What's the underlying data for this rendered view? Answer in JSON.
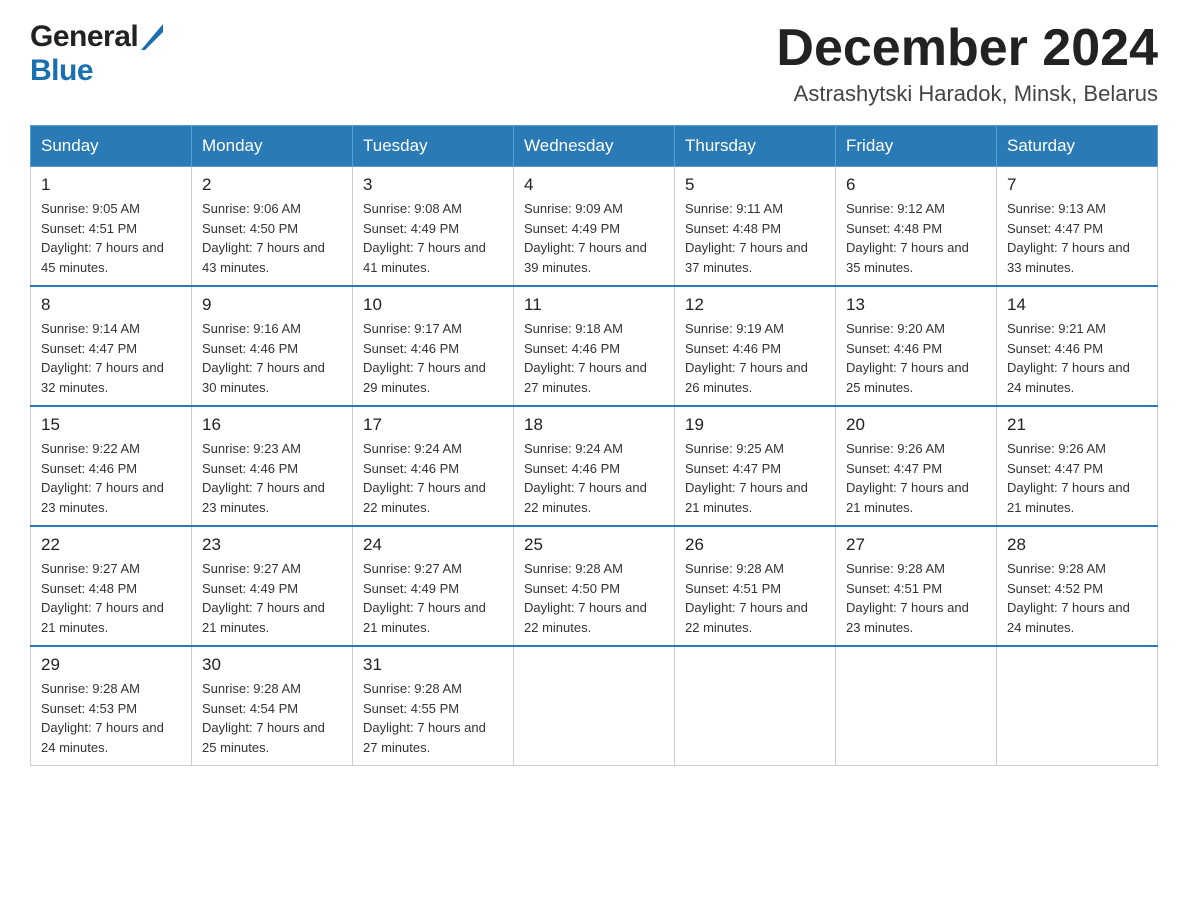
{
  "header": {
    "logo_general": "General",
    "logo_blue": "Blue",
    "title": "December 2024",
    "location": "Astrashytski Haradok, Minsk, Belarus"
  },
  "weekdays": [
    "Sunday",
    "Monday",
    "Tuesday",
    "Wednesday",
    "Thursday",
    "Friday",
    "Saturday"
  ],
  "weeks": [
    [
      {
        "day": "1",
        "sunrise": "9:05 AM",
        "sunset": "4:51 PM",
        "daylight": "7 hours and 45 minutes."
      },
      {
        "day": "2",
        "sunrise": "9:06 AM",
        "sunset": "4:50 PM",
        "daylight": "7 hours and 43 minutes."
      },
      {
        "day": "3",
        "sunrise": "9:08 AM",
        "sunset": "4:49 PM",
        "daylight": "7 hours and 41 minutes."
      },
      {
        "day": "4",
        "sunrise": "9:09 AM",
        "sunset": "4:49 PM",
        "daylight": "7 hours and 39 minutes."
      },
      {
        "day": "5",
        "sunrise": "9:11 AM",
        "sunset": "4:48 PM",
        "daylight": "7 hours and 37 minutes."
      },
      {
        "day": "6",
        "sunrise": "9:12 AM",
        "sunset": "4:48 PM",
        "daylight": "7 hours and 35 minutes."
      },
      {
        "day": "7",
        "sunrise": "9:13 AM",
        "sunset": "4:47 PM",
        "daylight": "7 hours and 33 minutes."
      }
    ],
    [
      {
        "day": "8",
        "sunrise": "9:14 AM",
        "sunset": "4:47 PM",
        "daylight": "7 hours and 32 minutes."
      },
      {
        "day": "9",
        "sunrise": "9:16 AM",
        "sunset": "4:46 PM",
        "daylight": "7 hours and 30 minutes."
      },
      {
        "day": "10",
        "sunrise": "9:17 AM",
        "sunset": "4:46 PM",
        "daylight": "7 hours and 29 minutes."
      },
      {
        "day": "11",
        "sunrise": "9:18 AM",
        "sunset": "4:46 PM",
        "daylight": "7 hours and 27 minutes."
      },
      {
        "day": "12",
        "sunrise": "9:19 AM",
        "sunset": "4:46 PM",
        "daylight": "7 hours and 26 minutes."
      },
      {
        "day": "13",
        "sunrise": "9:20 AM",
        "sunset": "4:46 PM",
        "daylight": "7 hours and 25 minutes."
      },
      {
        "day": "14",
        "sunrise": "9:21 AM",
        "sunset": "4:46 PM",
        "daylight": "7 hours and 24 minutes."
      }
    ],
    [
      {
        "day": "15",
        "sunrise": "9:22 AM",
        "sunset": "4:46 PM",
        "daylight": "7 hours and 23 minutes."
      },
      {
        "day": "16",
        "sunrise": "9:23 AM",
        "sunset": "4:46 PM",
        "daylight": "7 hours and 23 minutes."
      },
      {
        "day": "17",
        "sunrise": "9:24 AM",
        "sunset": "4:46 PM",
        "daylight": "7 hours and 22 minutes."
      },
      {
        "day": "18",
        "sunrise": "9:24 AM",
        "sunset": "4:46 PM",
        "daylight": "7 hours and 22 minutes."
      },
      {
        "day": "19",
        "sunrise": "9:25 AM",
        "sunset": "4:47 PM",
        "daylight": "7 hours and 21 minutes."
      },
      {
        "day": "20",
        "sunrise": "9:26 AM",
        "sunset": "4:47 PM",
        "daylight": "7 hours and 21 minutes."
      },
      {
        "day": "21",
        "sunrise": "9:26 AM",
        "sunset": "4:47 PM",
        "daylight": "7 hours and 21 minutes."
      }
    ],
    [
      {
        "day": "22",
        "sunrise": "9:27 AM",
        "sunset": "4:48 PM",
        "daylight": "7 hours and 21 minutes."
      },
      {
        "day": "23",
        "sunrise": "9:27 AM",
        "sunset": "4:49 PM",
        "daylight": "7 hours and 21 minutes."
      },
      {
        "day": "24",
        "sunrise": "9:27 AM",
        "sunset": "4:49 PM",
        "daylight": "7 hours and 21 minutes."
      },
      {
        "day": "25",
        "sunrise": "9:28 AM",
        "sunset": "4:50 PM",
        "daylight": "7 hours and 22 minutes."
      },
      {
        "day": "26",
        "sunrise": "9:28 AM",
        "sunset": "4:51 PM",
        "daylight": "7 hours and 22 minutes."
      },
      {
        "day": "27",
        "sunrise": "9:28 AM",
        "sunset": "4:51 PM",
        "daylight": "7 hours and 23 minutes."
      },
      {
        "day": "28",
        "sunrise": "9:28 AM",
        "sunset": "4:52 PM",
        "daylight": "7 hours and 24 minutes."
      }
    ],
    [
      {
        "day": "29",
        "sunrise": "9:28 AM",
        "sunset": "4:53 PM",
        "daylight": "7 hours and 24 minutes."
      },
      {
        "day": "30",
        "sunrise": "9:28 AM",
        "sunset": "4:54 PM",
        "daylight": "7 hours and 25 minutes."
      },
      {
        "day": "31",
        "sunrise": "9:28 AM",
        "sunset": "4:55 PM",
        "daylight": "7 hours and 27 minutes."
      },
      null,
      null,
      null,
      null
    ]
  ]
}
